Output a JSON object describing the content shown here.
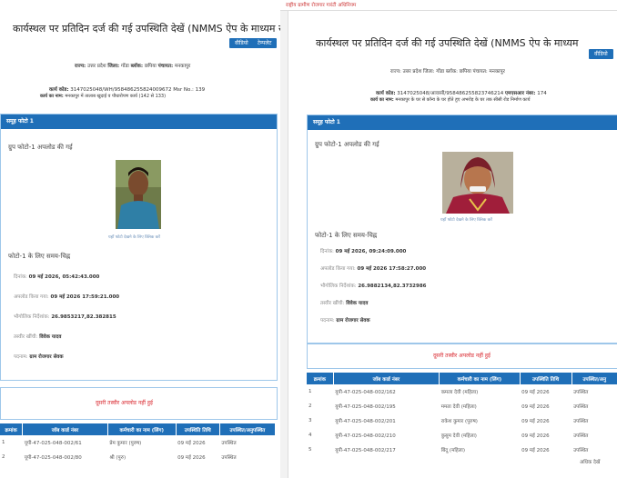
{
  "top_banner": "राष्ट्रीय ग्रामीण रोजगार गारंटी अधिनियम",
  "left": {
    "title": "कार्यस्थल पर प्रतिदिन दर्ज की गई उपस्थिति देखें (NMMS ऐप के माध्यम से)",
    "buttons": [
      "वीडियो",
      "टेम्पलेट"
    ],
    "location": {
      "state_label": "राज्य:",
      "state": "उत्तर प्रदेश",
      "district_label": "जिला:",
      "district": "गोंडा",
      "block_label": "ब्लॉक:",
      "block": "छपिया",
      "gp_label": "पंचायत:",
      "gp": "मनकापुर"
    },
    "work_code_label": "कार्य कोड:",
    "work_code": "3147025048/WH/958486255824009672 Msr No.: 139",
    "work_name_label": "कार्य का नाम:",
    "work_name": "मनकापुर में तालाब खुदाई व पौधारोपण कार्य (142 से 133)",
    "panel_title": "समूह फोटो 1",
    "upload_text": "ग्रुप फोटो-1 अपलोड की गई",
    "photo_caption": "यहाँ फोटो देखने के लिए क्लिक करें",
    "timestamp_heading": "फोटो-1 के लिए समय-चिह्न",
    "fields": [
      {
        "k": "दिनांक:",
        "v": "09 मई 2026, 05:42:43.000"
      },
      {
        "k": "अपलोड किया गया:",
        "v": "09 मई 2026 17:59:21.000"
      },
      {
        "k": "भौगोलिक निर्देशांक:",
        "v": "26.9853217,82.382815"
      },
      {
        "k": "तस्वीर खींची:",
        "v": "विवेक यादव"
      },
      {
        "k": "पदनाम:",
        "v": "ग्राम रोजगार सेवक"
      }
    ],
    "second_photo": "दूसरी तस्वीर अपलोड नहीं हुई",
    "table_headers": [
      "क्रमांक",
      "जॉब कार्ड नंबर",
      "कर्मचारी का नाम (लिंग)",
      "उपस्थिति तिथि",
      "उपस्थित/अनुपस्थित"
    ],
    "rows": [
      [
        "1",
        "यूपी-47-025-048-002/61",
        "प्रेम कुमार (पुरुष)",
        "09 मई 2026",
        "उपस्थित"
      ],
      [
        "2",
        "यूपी-47-025-048-002/80",
        "श्री (पुरु)",
        "09 मई 2026",
        "उपस्थित"
      ]
    ]
  },
  "right": {
    "title": "कार्यस्थल पर प्रतिदिन दर्ज की गई उपस्थिति देखें (NMMS ऐप के माध्यम",
    "buttons": [
      "वीडियो"
    ],
    "location": "राज्य: उत्तर प्रदेश जिला: गोंडा ब्लॉक: छपिया पंचायत: मनकापुर",
    "work_code_label": "कार्य कोड:",
    "work_code": "3147025048/आवासी/958486255823746214",
    "msr_label": "एमएसआर नंबर:",
    "msr": "174",
    "work_name_label": "कार्य का नाम:",
    "work_name": "मनकापुर के घर से कॉन्व के घर होते हुए अभरोड़ के घर तक सीसी रोड निर्माण कार्य",
    "panel_title": "समूह फोटो 1",
    "upload_text": "ग्रुप फोटो-1 अपलोड की गई",
    "photo_caption": "यहाँ फोटो देखने के लिए क्लिक करें",
    "timestamp_heading": "फोटो-1 के लिए समय-चिह्न",
    "fields": [
      {
        "k": "दिनांक:",
        "v": "09 मई 2026, 09:24:09.000"
      },
      {
        "k": "अपलोड किया गया:",
        "v": "09 मई 2026 17:58:27.000"
      },
      {
        "k": "भौगोलिक निर्देशांक:",
        "v": "26.9882134,82.3732986"
      },
      {
        "k": "तस्वीर खींची:",
        "v": "विवेक यादव"
      },
      {
        "k": "पदनाम:",
        "v": "ग्राम रोजगार सेवक"
      }
    ],
    "second_photo": "दूसरी तस्वीर अपलोड नहीं हुई",
    "table_headers": [
      "क्रमांक",
      "जॉब कार्ड नंबर",
      "कर्मचारी का नाम (लिंग)",
      "उपस्थिति तिथि",
      "उपस्थित/अनु"
    ],
    "rows": [
      [
        "1",
        "यूपी-47-025-048-002/162",
        "कमला देवी (महिला)",
        "09 मई 2026",
        "उपस्थित"
      ],
      [
        "2",
        "यूपी-47-025-048-002/195",
        "ममता देवी (महिला)",
        "09 मई 2026",
        "उपस्थित"
      ],
      [
        "3",
        "यूपी-47-025-048-002/201",
        "राकेश कुमार (पुरुष)",
        "09 मई 2026",
        "उपस्थित"
      ],
      [
        "4",
        "यूपी-47-025-048-002/210",
        "कुसुम देवी (महिला)",
        "09 मई 2026",
        "उपस्थित"
      ],
      [
        "5",
        "यूपी-47-025-048-002/217",
        "बिंदू (महिला)",
        "09 मई 2026",
        "उपस्थित"
      ]
    ],
    "footer_text": "अधिक देखें"
  }
}
